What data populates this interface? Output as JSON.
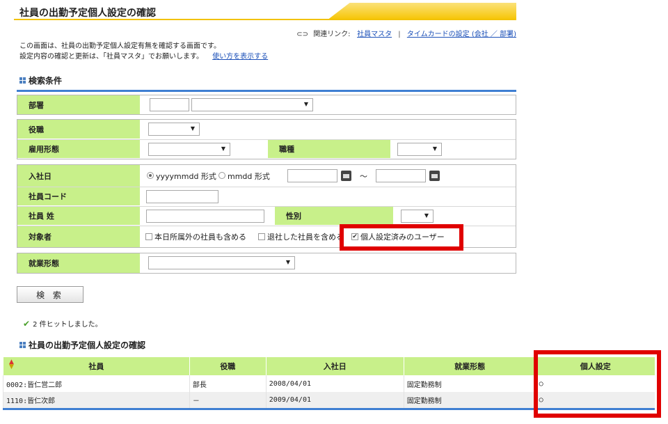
{
  "header": {
    "title": "社員の出勤予定個人設定の確認",
    "related_label": "関連リンク:",
    "links": [
      "社員マスタ",
      "タイムカードの設定 (会社 ／ 部署)"
    ],
    "separator": "|"
  },
  "description": {
    "line1": "この画面は、社員の出勤予定個人設定有無を確認する画面です。",
    "line2": "設定内容の確認と更新は、「社員マスタ」でお願いします。",
    "help_link": "使い方を表示する"
  },
  "search": {
    "section_title": "検索条件",
    "labels": {
      "department": "部署",
      "position": "役職",
      "employment_type": "雇用形態",
      "job_type": "職種",
      "hire_date": "入社日",
      "employee_code": "社員コード",
      "last_name": "社員 姓",
      "gender": "性別",
      "target": "対象者",
      "work_type": "就業形態"
    },
    "date_format_1": "yyyymmdd 形式",
    "date_format_2": "mmdd 形式",
    "tilde": "～",
    "check_include_other_dept": "本日所属外の社員も含める",
    "check_include_retired": "退社した社員を含める",
    "check_personal_set": "個人設定済みのユーザー",
    "checked_mark": "✔",
    "button_label": "検 索"
  },
  "hits": {
    "text": "2 件ヒットしました。"
  },
  "results": {
    "section_title": "社員の出勤予定個人設定の確認",
    "columns": [
      "社員",
      "役職",
      "入社日",
      "就業形態",
      "個人設定"
    ],
    "rows": [
      [
        "0002:皆仁営二郎",
        "部長",
        "2008/04/01",
        "固定勤務制",
        "○"
      ],
      [
        "1110:皆仁次郎",
        "－",
        "2009/04/01",
        "固定勤務制",
        "○"
      ]
    ]
  },
  "colors": {
    "label_bg": "#c8f08a",
    "accent_blue": "#3f7fd2",
    "highlight": "#e00000",
    "title_band": "#f2c200"
  },
  "icons": [
    "chain-link-icon",
    "grid-square-icon",
    "calendar-icon",
    "check-mark-icon",
    "sort-arrow-icon",
    "dropdown-arrow-icon"
  ]
}
